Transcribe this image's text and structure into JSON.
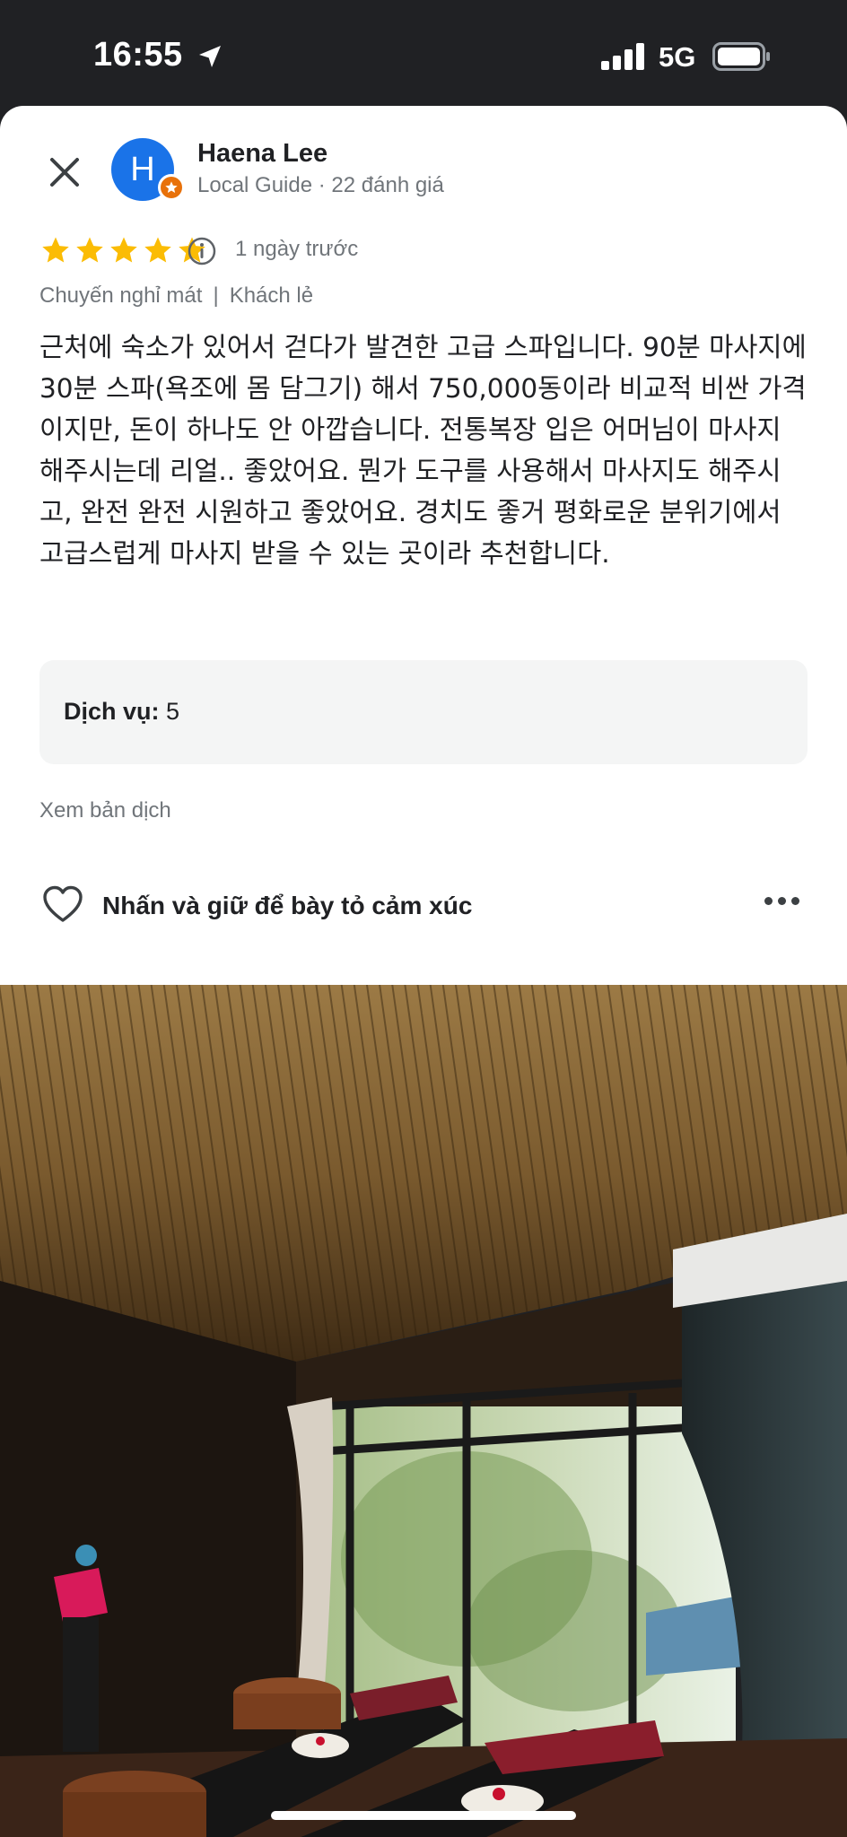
{
  "status_bar": {
    "time": "16:55",
    "network": "5G"
  },
  "reviewer": {
    "initial": "H",
    "name": "Haena Lee",
    "meta": "Local Guide · 22 đánh giá"
  },
  "rating": {
    "stars": 5,
    "time_ago": "1 ngày trước"
  },
  "trip": {
    "type": "Chuyến nghỉ mát",
    "separator": "|",
    "group": "Khách lẻ"
  },
  "review_text": "근처에 숙소가 있어서 걷다가 발견한 고급 스파입니다. 90분 마사지에 30분 스파(욕조에 몸 담그기) 해서 750,000동이라 비교적 비싼 가격이지만, 돈이 하나도 안 아깝습니다. 전통복장 입은 어머님이 마사지 해주시는데 리얼.. 좋았어요. 뭔가 도구를 사용해서 마사지도 해주시고, 완전 완전 시원하고 좋았어요. 경치도 좋거 평화로운 분위기에서 고급스럽게 마사지 받을 수 있는 곳이라 추천합니다.",
  "service": {
    "label": "Dịch vụ:",
    "value": "5"
  },
  "translate_label": "Xem bản dịch",
  "reaction": {
    "label": "Nhấn và giữ để bày tỏ cảm xúc"
  },
  "icons": [
    "location-arrow-icon",
    "signal-icon",
    "battery-icon",
    "close-icon",
    "star-icon",
    "info-icon",
    "heart-icon",
    "more-icon"
  ],
  "colors": {
    "star": "#fbbc04",
    "avatar": "#1a73e8",
    "badge": "#e8710a",
    "muted_text": "#70757a"
  }
}
